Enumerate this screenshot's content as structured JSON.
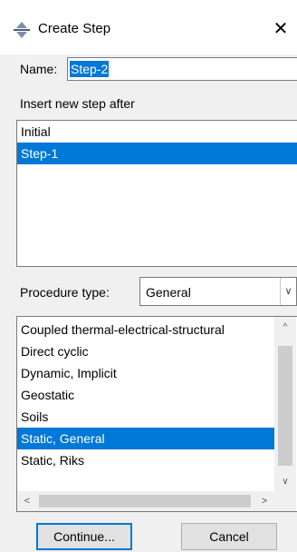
{
  "window": {
    "title": "Create Step",
    "icon": "step-icon",
    "close_glyph": "✕"
  },
  "name": {
    "label": "Name:",
    "value": "Step-2"
  },
  "insert_after": {
    "label": "Insert new step after",
    "items": [
      "Initial",
      "Step-1"
    ],
    "selected": "Step-1"
  },
  "procedure": {
    "label": "Procedure type:",
    "selected": "General",
    "items": [
      "Coupled thermal-electrical-structural",
      "Direct cyclic",
      "Dynamic, Implicit",
      "Geostatic",
      "Soils",
      "Static, General",
      "Static, Riks"
    ],
    "selected_item": "Static, General"
  },
  "buttons": {
    "continue": "Continue...",
    "cancel": "Cancel"
  },
  "colors": {
    "selection": "#0078d7",
    "dialog_bg": "#f0f0f0"
  }
}
